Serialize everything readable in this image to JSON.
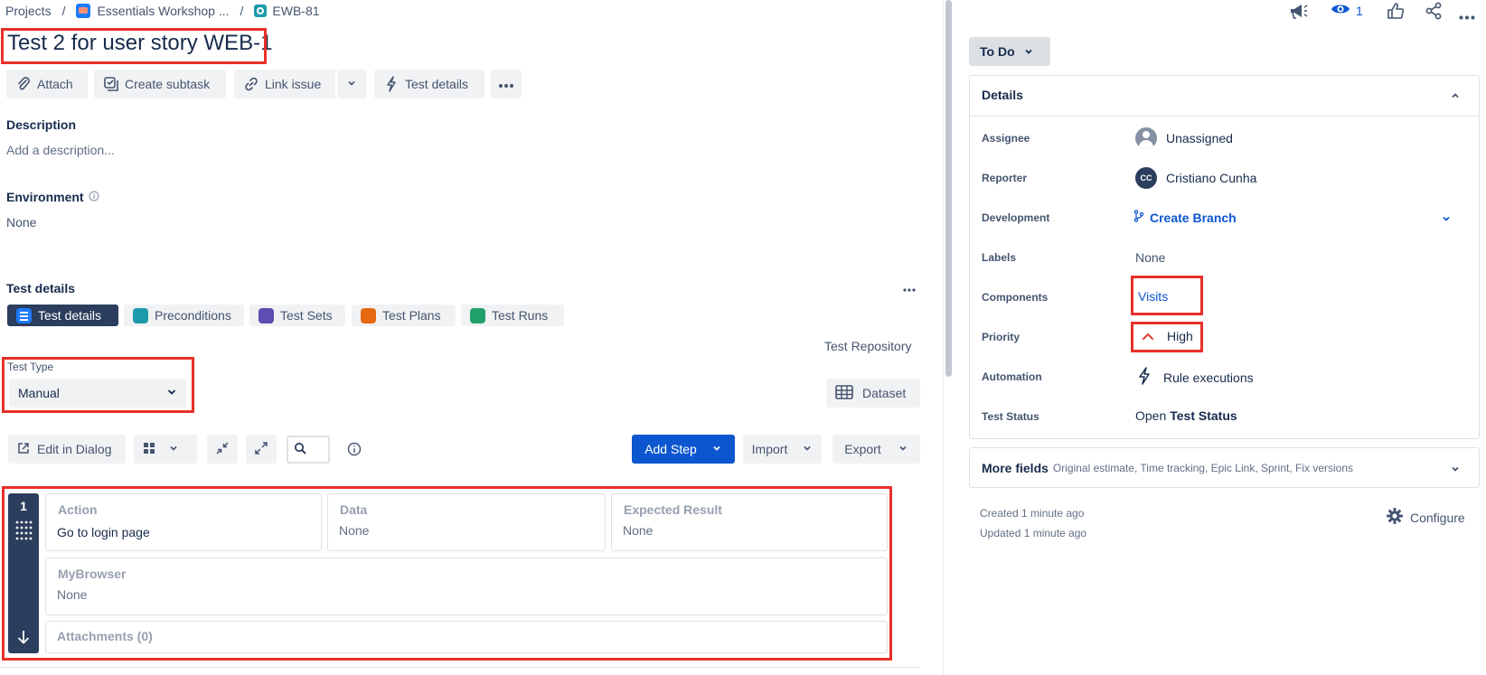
{
  "breadcrumb": {
    "projects": "Projects",
    "sep1": "/",
    "project": "Essentials Workshop ...",
    "sep2": "/",
    "issue_key": "EWB-81"
  },
  "issue": {
    "title": "Test 2 for user story WEB-1"
  },
  "toolbar": {
    "attach": "Attach",
    "create_subtask": "Create subtask",
    "link_issue": "Link issue",
    "test_details": "Test details"
  },
  "description": {
    "label": "Description",
    "placeholder": "Add a description..."
  },
  "environment": {
    "label": "Environment",
    "value": "None"
  },
  "test_section": {
    "label": "Test details",
    "tabs": [
      {
        "label": "Test details",
        "color": "#0c66e4"
      },
      {
        "label": "Preconditions",
        "color": "#1d9aaa"
      },
      {
        "label": "Test Sets",
        "color": "#5e4db2"
      },
      {
        "label": "Test Plans",
        "color": "#e56910"
      },
      {
        "label": "Test Runs",
        "color": "#22a06b"
      }
    ],
    "repository": "Test Repository",
    "test_type_label": "Test Type",
    "test_type_value": "Manual",
    "dataset": "Dataset",
    "edit_in_dialog": "Edit in Dialog",
    "add_step": "Add Step",
    "import": "Import",
    "export": "Export"
  },
  "step": {
    "number": "1",
    "action_label": "Action",
    "action_value": "Go to login page",
    "data_label": "Data",
    "data_value": "None",
    "expected_label": "Expected Result",
    "expected_value": "None",
    "browser_label": "MyBrowser",
    "browser_value": "None",
    "attachments": "Attachments (0)"
  },
  "topbar": {
    "watchers": "1"
  },
  "status": {
    "label": "To Do"
  },
  "details": {
    "title": "Details",
    "assignee_label": "Assignee",
    "assignee_value": "Unassigned",
    "reporter_label": "Reporter",
    "reporter_value": "Cristiano Cunha",
    "reporter_initials": "CC",
    "development_label": "Development",
    "development_value": "Create Branch",
    "labels_label": "Labels",
    "labels_value": "None",
    "components_label": "Components",
    "components_value": "Visits",
    "priority_label": "Priority",
    "priority_value": "High",
    "automation_label": "Automation",
    "automation_value": "Rule executions",
    "test_status_label": "Test Status",
    "test_status_prefix": "Open",
    "test_status_value": "Test Status"
  },
  "more_fields": {
    "label": "More fields",
    "hint": "Original estimate, Time tracking, Epic Link, Sprint, Fix versions"
  },
  "meta": {
    "created": "Created 1 minute ago",
    "updated": "Updated 1 minute ago",
    "configure": "Configure"
  },
  "colors": {
    "accent": "#0c66e4",
    "primary_button": "#0c56d0",
    "dark_tab": "#2c3e5d",
    "highlight": "#e8302a"
  }
}
